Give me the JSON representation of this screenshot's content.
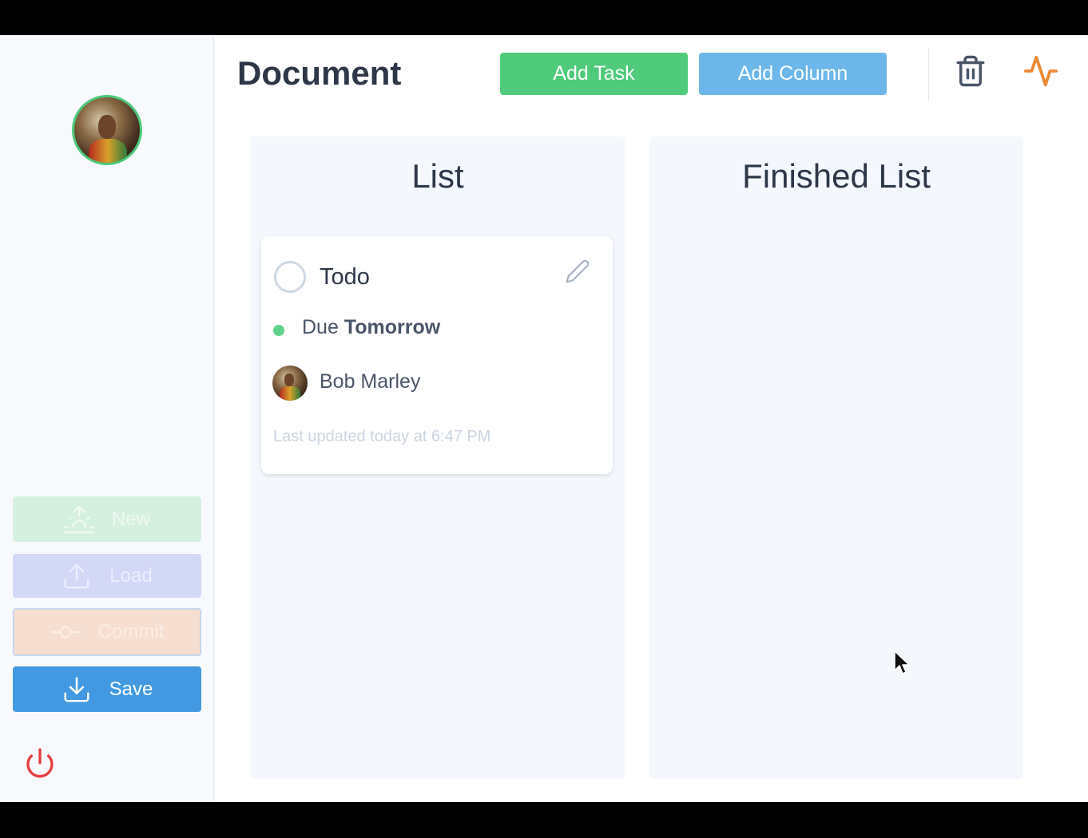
{
  "header": {
    "title": "Document",
    "add_task_label": "Add Task",
    "add_column_label": "Add Column",
    "icons": [
      "trash-icon",
      "activity-icon"
    ]
  },
  "sidebar": {
    "buttons": [
      {
        "label": "New",
        "icon": "sunrise-icon",
        "color": "#d6f0e0"
      },
      {
        "label": "Load",
        "icon": "upload-icon",
        "color": "#d4d8f7"
      },
      {
        "label": "Commit",
        "icon": "git-commit-icon",
        "color": "#f6ded1"
      },
      {
        "label": "Save",
        "icon": "download-icon",
        "color": "#4299e1"
      }
    ],
    "power_icon": "power-icon"
  },
  "columns": [
    {
      "title": "List",
      "cards": [
        {
          "title": "Todo",
          "due_prefix": "Due",
          "due_value": "Tomorrow",
          "assignee": "Bob Marley",
          "updated": "Last updated today at 6:47 PM"
        }
      ]
    },
    {
      "title": "Finished List",
      "cards": []
    }
  ],
  "colors": {
    "accent_green": "#4fcb7b",
    "accent_blue": "#6cb6ea",
    "save_blue": "#4299e1",
    "power_red": "#e53e3e",
    "activity_orange": "#ed8936"
  }
}
